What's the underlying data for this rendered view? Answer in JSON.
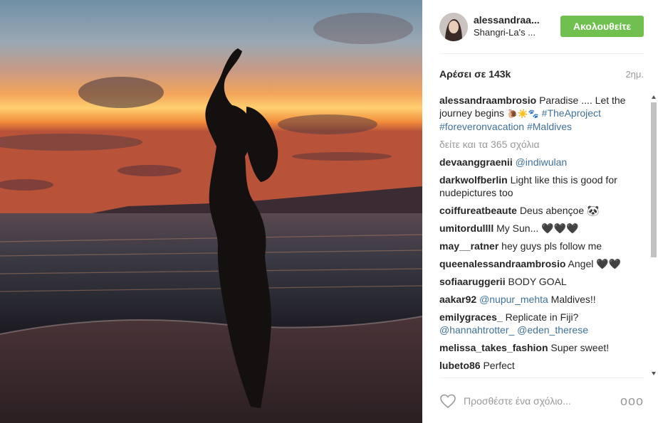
{
  "post": {
    "username": "alessandraa...",
    "location": "Shangri-La's ...",
    "follow_label": "Ακολουθείτε",
    "likes": "Αρέσει σε 143k",
    "timestamp": "2ημ."
  },
  "caption": {
    "user": "alessandraambrosio",
    "text": "Paradise .... Let the journey begins",
    "emoji": "🐌☀️🐾",
    "tags": [
      "#TheAproject",
      "#foreveronvacation",
      "#Maldives"
    ]
  },
  "view_all": "δείτε και τα 365 σχόλια",
  "comments": [
    {
      "user": "devaanggraenii",
      "mention": "@indiwulan",
      "text": ""
    },
    {
      "user": "darkwolfberlin",
      "mention": "",
      "text": "Light like this is good for nudepictures too"
    },
    {
      "user": "coiffureatbeaute",
      "mention": "",
      "text": "Deus abençoe 🐼"
    },
    {
      "user": "umitordullll",
      "mention": "",
      "text": "My Sun... 🖤🖤🖤"
    },
    {
      "user": "may__ratner",
      "mention": "",
      "text": "hey guys pls follow me"
    },
    {
      "user": "queenalessandraambrosio",
      "mention": "",
      "text": "Angel 🖤🖤"
    },
    {
      "user": "sofiaaruggerii",
      "mention": "",
      "text": "BODY GOAL"
    },
    {
      "user": "aakar92",
      "mention": "@nupur_mehta",
      "text": "Maldives!!"
    },
    {
      "user": "emilygraces_",
      "mention": "",
      "text": "Replicate in Fiji?",
      "mentions2": "@hannahtrotter_ @eden_therese"
    },
    {
      "user": "melissa_takes_fashion",
      "mention": "",
      "text": "Super sweet!"
    },
    {
      "user": "lubeto86",
      "mention": "",
      "text": "Perfect"
    }
  ],
  "footer": {
    "placeholder": "Προσθέστε ένα σχόλιο...",
    "more": "ooo"
  },
  "colors": {
    "follow_button": "#70c050",
    "link": "#3f729b",
    "muted": "#999999"
  },
  "icons": [
    "heart-icon",
    "more-options-icon",
    "scroll-up-arrow",
    "scroll-down-arrow"
  ]
}
